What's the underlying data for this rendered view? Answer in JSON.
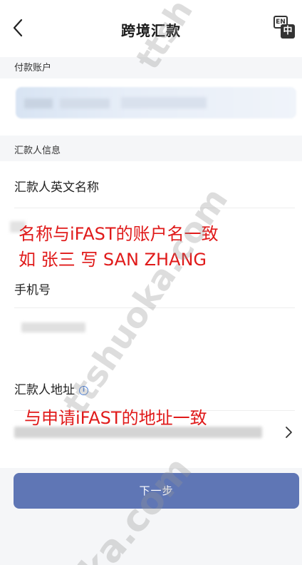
{
  "header": {
    "title": "跨境汇款",
    "lang_en": "EN",
    "lang_zh": "中"
  },
  "payment_account": {
    "section_label": "付款账户"
  },
  "remitter_info": {
    "section_label": "汇款人信息",
    "english_name_label": "汇款人英文名称",
    "phone_label": "手机号",
    "address_label": "汇款人地址"
  },
  "annotations": {
    "name_line1": "名称与iFAST的账户名一致",
    "name_line2": "如 张三  写 SAN ZHANG",
    "address_line": "与申请iFAST的地址一致"
  },
  "footer": {
    "next_label": "下一步"
  },
  "watermarks": {
    "top": "ttsh",
    "middle": "ttshuoka.com",
    "bottom": "ka.com"
  },
  "colors": {
    "button": "#5f76b5",
    "annotation": "#e01a1a",
    "info_icon": "#4a7fd6"
  }
}
